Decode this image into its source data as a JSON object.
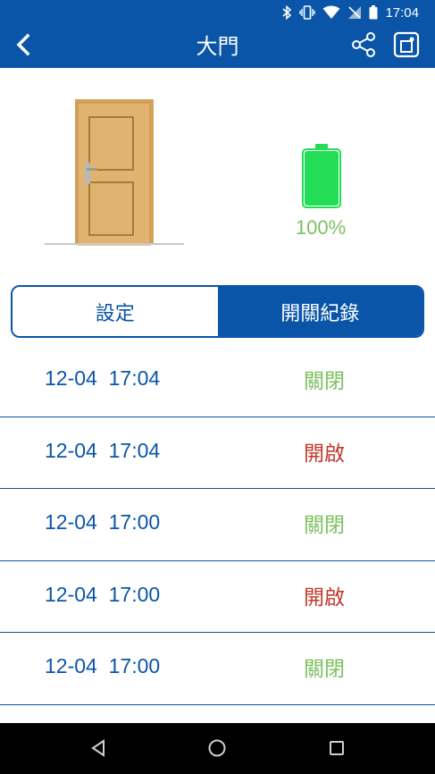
{
  "status_bar": {
    "time": "17:04",
    "icons": [
      "bluetooth-icon",
      "vibrate-icon",
      "wifi-icon",
      "no-signal-icon",
      "battery-icon"
    ]
  },
  "app_bar": {
    "title": "大門",
    "back_icon": "chevron-left-icon",
    "share_icon": "share-icon",
    "device_icon": "device-info-icon"
  },
  "device": {
    "battery_percent_label": "100%",
    "battery_level": 1.0,
    "battery_color": "#22dd55"
  },
  "tabs": [
    {
      "label": "設定",
      "active": false
    },
    {
      "label": "開關紀錄",
      "active": true
    }
  ],
  "log": [
    {
      "datetime": "12-04  17:04",
      "status": "關閉",
      "state": "closed"
    },
    {
      "datetime": "12-04  17:04",
      "status": "開啟",
      "state": "opened"
    },
    {
      "datetime": "12-04  17:00",
      "status": "關閉",
      "state": "closed"
    },
    {
      "datetime": "12-04  17:00",
      "status": "開啟",
      "state": "opened"
    },
    {
      "datetime": "12-04  17:00",
      "status": "關閉",
      "state": "closed"
    }
  ],
  "colors": {
    "primary": "#0a55a8",
    "closed": "#7cc05f",
    "opened": "#c0392b"
  },
  "nav": [
    "back-triangle-icon",
    "home-circle-icon",
    "recents-square-icon"
  ]
}
